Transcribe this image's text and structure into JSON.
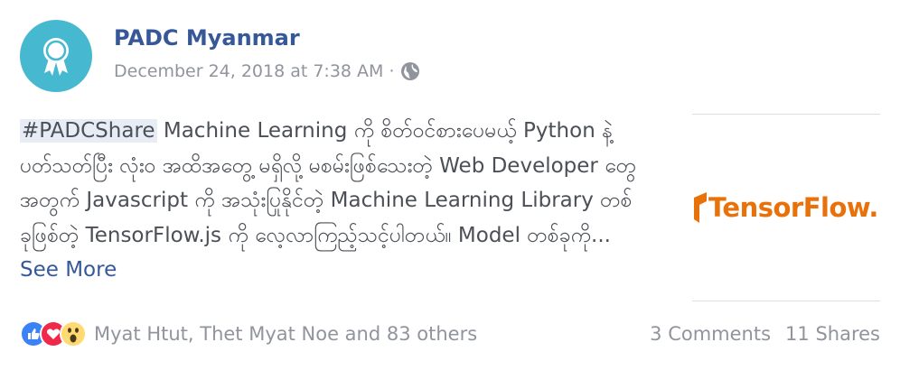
{
  "post": {
    "page_name": "PADC Myanmar",
    "timestamp": "December 24, 2018 at 7:38 AM",
    "separator": "·",
    "privacy_icon": "globe-icon",
    "avatar_icon": "award-ribbon-icon",
    "avatar_color": "#46b8d0",
    "hashtag": "#PADCShare",
    "body": " Machine Learning ကို စိတ်ဝင်စားပေမယ့် Python နဲ့ ပတ်သတ်ပြီး လုံးဝ အထိအတွေ့ မရှိလို့ မစမ်းဖြစ်သေးတဲ့ Web Developer တွေအတွက် Javascript ကို အသုံးပြုနိုင်တဲ့ Machine Learning Library တစ်ခုဖြစ်တဲ့ TensorFlow.js ကို လေ့လာကြည့်သင့်ပါတယ်။ Model တစ်ခုကို... ",
    "see_more": "See More"
  },
  "link_preview": {
    "logo_text": "TensorFlow.",
    "logo_color": "#e8710a"
  },
  "footer": {
    "reaction_icons": [
      "like-icon",
      "love-icon",
      "wow-icon"
    ],
    "reactors": "Myat Htut, Thet Myat Noe and 83 others",
    "comments": "3 Comments",
    "shares": "11 Shares"
  }
}
